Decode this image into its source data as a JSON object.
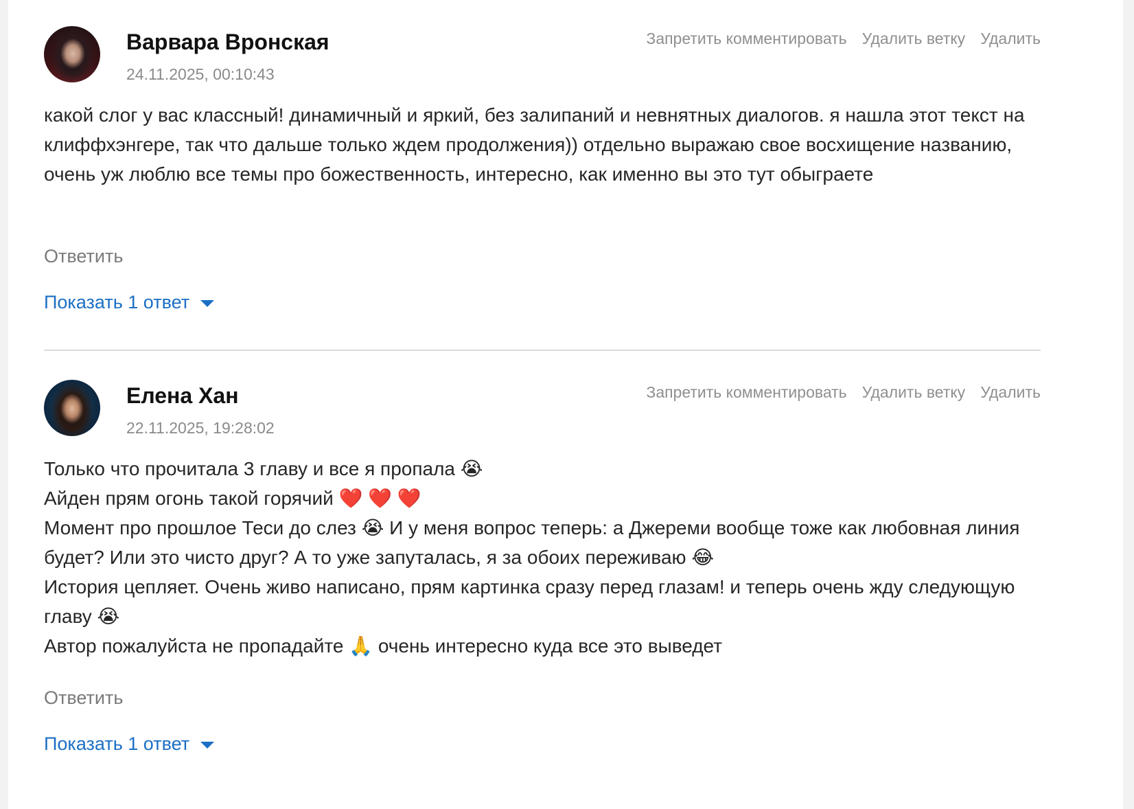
{
  "actions": {
    "ban_label": "Запретить комментировать",
    "delete_branch_label": "Удалить ветку",
    "delete_label": "Удалить"
  },
  "comments": [
    {
      "author": "Варвара Вронская",
      "date": "24.11.2025, 00:10:43",
      "lines": [
        "какой слог у вас классный! динамичный и яркий, без залипаний и невнятных диалогов. я нашла этот текст на клиффхэнгере, так что дальше только ждем продолжения)) отдельно выражаю свое восхищение названию, очень уж люблю все темы про божественность, интересно, как именно вы это тут обыграете"
      ],
      "reply_label": "Ответить",
      "show_replies_label": "Показать 1 ответ"
    },
    {
      "author": "Елена Хан",
      "date": "22.11.2025, 19:28:02",
      "lines": [
        "Только что прочитала 3 главу и все я пропала 😭",
        "Айден прям огонь такой горячий ❤️ ❤️ ❤️",
        "Момент про прошлое Теси до слез 😭 И у меня вопрос теперь: а Джереми вообще тоже как любовная линия будет? Или это чисто друг? А то уже запуталась, я за обоих переживаю 😂",
        "История цепляет. Очень живо написано, прям картинка сразу перед глазам! и теперь очень жду следующую главу 😭",
        "Автор пожалуйста не пропадайте 🙏 очень интересно куда все это выведет"
      ],
      "reply_label": "Ответить",
      "show_replies_label": "Показать 1 ответ"
    }
  ],
  "icons": {
    "show_replies": "caret-down-icon"
  },
  "colors": {
    "link_blue": "#1b6fc4",
    "muted_gray": "#8f8f8f",
    "text": "#262626"
  }
}
